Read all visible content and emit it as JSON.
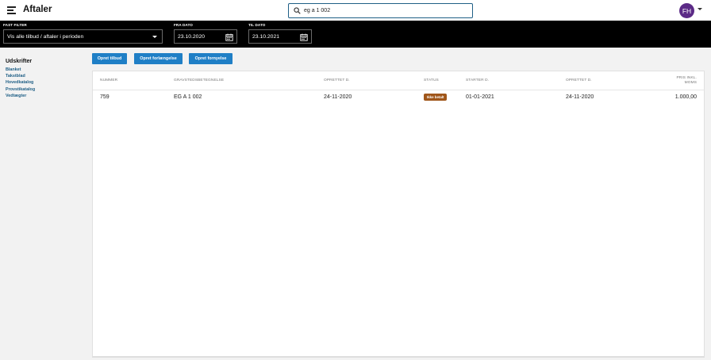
{
  "header": {
    "title": "Aftaler",
    "search_value": "eg a 1 002",
    "avatar_initials": "FH"
  },
  "filters": {
    "fast_filter_label": "FAST FILTER",
    "fast_filter_value": "Vis alle tilbud / aftaler i perioden",
    "from_label": "FRA DATO",
    "from_value": "23.10.2020",
    "to_label": "TIL DATO",
    "to_value": "23.10.2021"
  },
  "sidebar": {
    "title": "Udskrifter",
    "items": [
      "Blanket",
      "Takstblad",
      "Hovedkatalog",
      "Provstikatalog",
      "Vedtægter"
    ]
  },
  "actions": {
    "create_offer": "Opret tilbud",
    "create_extension": "Opret forlængelse",
    "create_renewal": "Opret fornyelse"
  },
  "table": {
    "columns": [
      "NUMMER",
      "GRAVSTEDSBETEGNELSE",
      "OPRETTET D.",
      "STATUS",
      "STARTER D.",
      "OPRETTET D.",
      "PRIS INKL.",
      "MOMS"
    ],
    "rows": [
      {
        "number": "759",
        "grave": "EG A 1 002",
        "created": "24-11-2020",
        "status": "Ikke betalt",
        "starts": "01-01-2021",
        "created2": "24-11-2020",
        "price": "1.000,00"
      }
    ]
  },
  "colors": {
    "accent": "#1f7fc6",
    "link": "#1f5f86",
    "avatar": "#5b2a86",
    "status_unpaid": "#a0561a"
  }
}
